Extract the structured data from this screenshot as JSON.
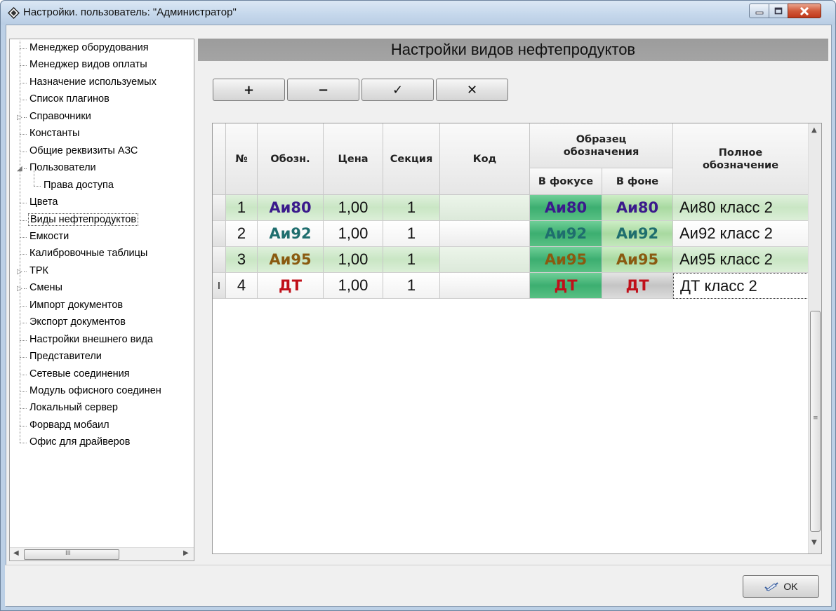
{
  "window": {
    "title": "Настройки. пользователь: \"Администратор\""
  },
  "tree": {
    "items": [
      {
        "label": "Менеджер оборудования"
      },
      {
        "label": "Менеджер видов оплаты"
      },
      {
        "label": "Назначение используемых"
      },
      {
        "label": "Список плагинов"
      },
      {
        "label": "Справочники",
        "expander": "collapsed"
      },
      {
        "label": "Константы"
      },
      {
        "label": "Общие реквизиты АЗС"
      },
      {
        "label": "Пользователи",
        "expander": "expanded"
      },
      {
        "label": "Права доступа",
        "child": true
      },
      {
        "label": "Цвета"
      },
      {
        "label": "Виды нефтепродуктов",
        "selected": true
      },
      {
        "label": "Емкости"
      },
      {
        "label": "Калибровочные таблицы"
      },
      {
        "label": "ТРК",
        "expander": "collapsed"
      },
      {
        "label": "Смены",
        "expander": "collapsed"
      },
      {
        "label": "Импорт документов"
      },
      {
        "label": "Экспорт документов"
      },
      {
        "label": "Настройки внешнего вида"
      },
      {
        "label": "Представители"
      },
      {
        "label": "Сетевые соединения"
      },
      {
        "label": "Модуль офисного соединен"
      },
      {
        "label": "Локальный сервер"
      },
      {
        "label": "Форвард мобаил"
      },
      {
        "label": "Офис для драйверов"
      }
    ]
  },
  "panel": {
    "title": "Настройки видов нефтепродуктов"
  },
  "toolbar": {
    "add_label": "+",
    "remove_label": "−",
    "apply_label": "✓",
    "cancel_label": "✕"
  },
  "table": {
    "headers": {
      "num": "№",
      "short": "Обозн.",
      "price": "Цена",
      "section": "Секция",
      "code": "Код",
      "sample": "Образец обозначения",
      "in_focus": "В фокусе",
      "in_background": "В фоне",
      "full": "Полное обозначение"
    },
    "rows": [
      {
        "num": "1",
        "short": "Аи80",
        "price": "1,00",
        "section": "1",
        "code": "",
        "in_focus": "Аи80",
        "in_background": "Аи80",
        "full": "Аи80 класс 2",
        "color": "#3b1a8c"
      },
      {
        "num": "2",
        "short": "Аи92",
        "price": "1,00",
        "section": "1",
        "code": "",
        "in_focus": "Аи92",
        "in_background": "Аи92",
        "full": "Аи92 класс 2",
        "color": "#1f6e6e"
      },
      {
        "num": "3",
        "short": "Аи95",
        "price": "1,00",
        "section": "1",
        "code": "",
        "in_focus": "Аи95",
        "in_background": "Аи95",
        "full": "Аи95 класс 2",
        "color": "#8a5a10"
      },
      {
        "num": "4",
        "short": "ДТ",
        "price": "1,00",
        "section": "1",
        "code": "",
        "in_focus": "ДТ",
        "in_background": "ДТ",
        "full": "ДТ класс 2",
        "color": "#c0101a"
      }
    ],
    "edit_cursor": "I"
  },
  "footer": {
    "ok_label": "OK"
  }
}
